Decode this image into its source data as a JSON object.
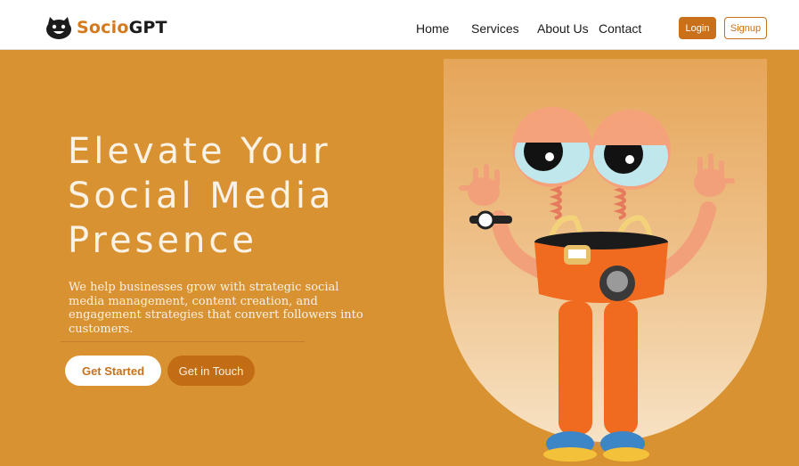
{
  "header": {
    "brand_part1": "Socio",
    "brand_part2": "GPT",
    "nav": [
      "Home",
      "Services",
      "About Us",
      "Contact"
    ],
    "login_label": "Login",
    "signup_label": "Signup"
  },
  "hero": {
    "headline_lines": [
      "Elevate Your",
      "Social Media",
      "Presence"
    ],
    "subtext": "We help businesses grow with strategic social media management, content creation, and engagement strategies that convert followers into customers.",
    "primary_cta": "Get Started",
    "secondary_cta": "Get in Touch"
  },
  "colors": {
    "brand_orange": "#c8711a",
    "hero_background": "#d99232",
    "header_background": "#ffffff"
  },
  "icons": {
    "logo": "smiling-face-logo-icon",
    "mascot": "3d-eyeball-robot-mascot"
  }
}
